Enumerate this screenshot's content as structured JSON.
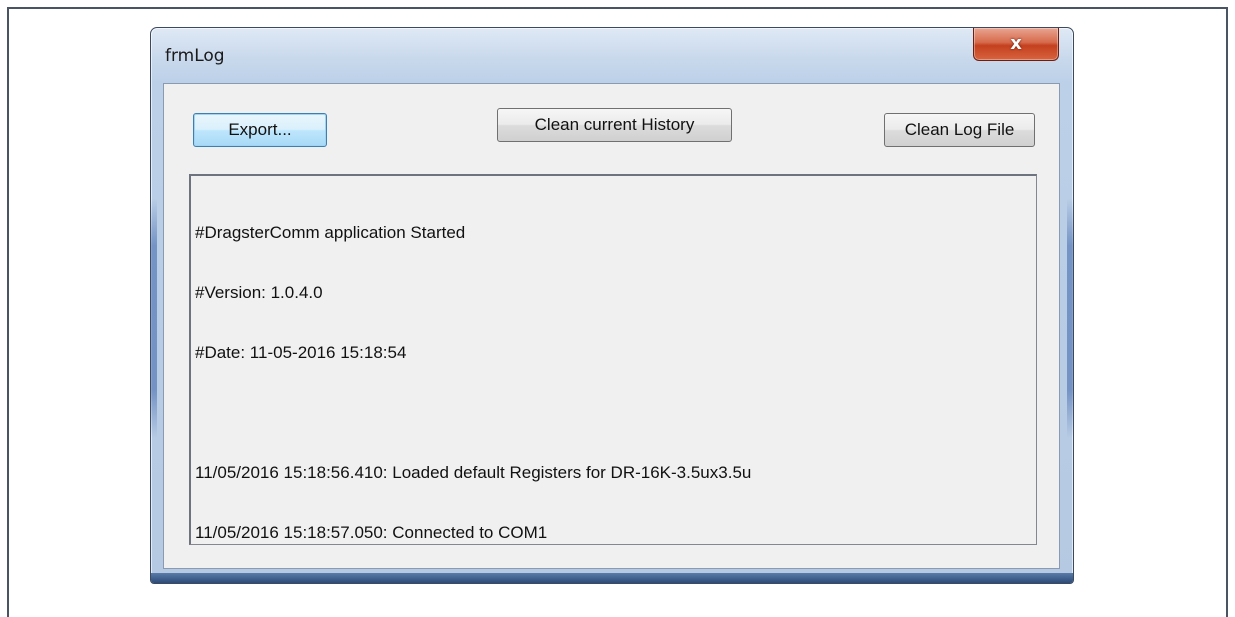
{
  "window": {
    "title": "frmLog",
    "close_glyph": "x"
  },
  "toolbar": {
    "export_label": "Export...",
    "clean_history_label": "Clean current History",
    "clean_logfile_label": "Clean Log File"
  },
  "log": {
    "lines": [
      "#DragsterComm application Started",
      "#Version: 1.0.4.0",
      "#Date: 11-05-2016 15:18:54",
      "",
      "11/05/2016 15:18:56.410: Loaded default Registers for DR-16K-3.5ux3.5u",
      "11/05/2016 15:18:57.050: Connected to COM1"
    ]
  },
  "colors": {
    "title_bar": "#c9d9ec",
    "close_button": "#c4401f",
    "client_background": "#f0f0f0",
    "focused_button_border": "#3c7fb1"
  }
}
